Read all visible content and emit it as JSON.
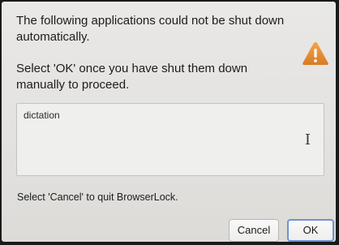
{
  "dialog": {
    "message_line1": "The following applications could not be shut down automatically.",
    "message_line2": "Select 'OK' once you have shut them down manually to proceed.",
    "icon": "warning-icon",
    "icon_color": "#e8913a",
    "app_list_value": "dictation",
    "footer_text": "Select 'Cancel' to quit BrowserLock.",
    "cancel_label": "Cancel",
    "ok_label": "OK",
    "ok_focus_color": "#6f93cf"
  }
}
